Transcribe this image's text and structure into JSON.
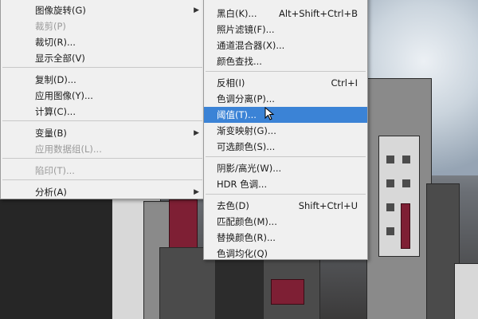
{
  "left_menu": {
    "items": [
      {
        "label": "图像旋转(G)",
        "disabled": false,
        "submenu": true
      },
      {
        "label": "裁剪(P)",
        "disabled": true
      },
      {
        "label": "裁切(R)...",
        "disabled": false
      },
      {
        "label": "显示全部(V)",
        "disabled": false
      },
      {
        "label": "复制(D)...",
        "disabled": false
      },
      {
        "label": "应用图像(Y)...",
        "disabled": false
      },
      {
        "label": "计算(C)...",
        "disabled": false
      },
      {
        "label": "变量(B)",
        "disabled": false,
        "submenu": true
      },
      {
        "label": "应用数据组(L)...",
        "disabled": true
      },
      {
        "label": "陷印(T)...",
        "disabled": true
      },
      {
        "label": "分析(A)",
        "disabled": false,
        "submenu": true
      }
    ]
  },
  "right_menu": {
    "items": [
      {
        "label": "黑白(K)...",
        "shortcut": "Alt+Shift+Ctrl+B"
      },
      {
        "label": "照片滤镜(F)...",
        "shortcut": ""
      },
      {
        "label": "通道混合器(X)...",
        "shortcut": ""
      },
      {
        "label": "颜色查找...",
        "shortcut": ""
      },
      {
        "label": "反相(I)",
        "shortcut": "Ctrl+I"
      },
      {
        "label": "色调分离(P)...",
        "shortcut": ""
      },
      {
        "label": "阈值(T)...",
        "shortcut": "",
        "highlight": true
      },
      {
        "label": "渐变映射(G)...",
        "shortcut": ""
      },
      {
        "label": "可选颜色(S)...",
        "shortcut": ""
      },
      {
        "label": "阴影/高光(W)...",
        "shortcut": ""
      },
      {
        "label": "HDR 色调...",
        "shortcut": ""
      },
      {
        "label": "去色(D)",
        "shortcut": "Shift+Ctrl+U"
      },
      {
        "label": "匹配颜色(M)...",
        "shortcut": ""
      },
      {
        "label": "替换颜色(R)...",
        "shortcut": ""
      },
      {
        "label": "色调均化(Q)",
        "shortcut": ""
      }
    ]
  },
  "colors": {
    "menu_bg": "#f0f0f0",
    "highlight": "#3b83d6",
    "disabled_text": "#9a9a9a"
  }
}
